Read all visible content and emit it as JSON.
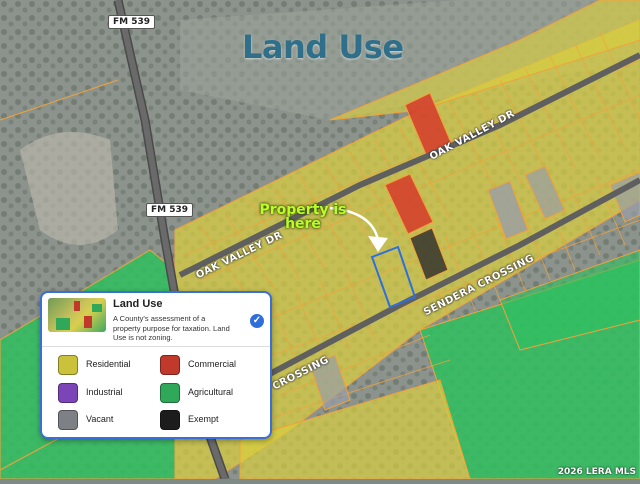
{
  "map": {
    "title": "Land Use",
    "road_shield_1": "FM 539",
    "road_shield_2": "FM 539",
    "street_oak_valley_1": "OAK VALLEY DR",
    "street_oak_valley_2": "OAK VALLEY DR",
    "street_sendera_1": "SENDERA CROSSING",
    "street_sendera_2": "CROSSING",
    "callout": "Property is here",
    "watermark": "2026 LERA MLS"
  },
  "legend": {
    "title": "Land Use",
    "description": "A County's assessment of a property purpose for taxation. Land Use is not zoning.",
    "items": [
      {
        "label": "Residential",
        "color": "#c9c23a"
      },
      {
        "label": "Commercial",
        "color": "#c0392b"
      },
      {
        "label": "Industrial",
        "color": "#7b45b8"
      },
      {
        "label": "Agricultural",
        "color": "#2fa85a"
      },
      {
        "label": "Vacant",
        "color": "#7d8084"
      },
      {
        "label": "Exempt",
        "color": "#1c1c1c"
      }
    ]
  },
  "colors": {
    "residential_fill": "#d9cf3f",
    "commercial_fill": "#d63a2a",
    "agricultural_fill": "#2fbf5f",
    "vacant_fill": "#9a9ea6",
    "parcel_outline": "#f2a23a",
    "subject_outline": "#2f6fdb",
    "check_color": "#2f6fdb"
  }
}
